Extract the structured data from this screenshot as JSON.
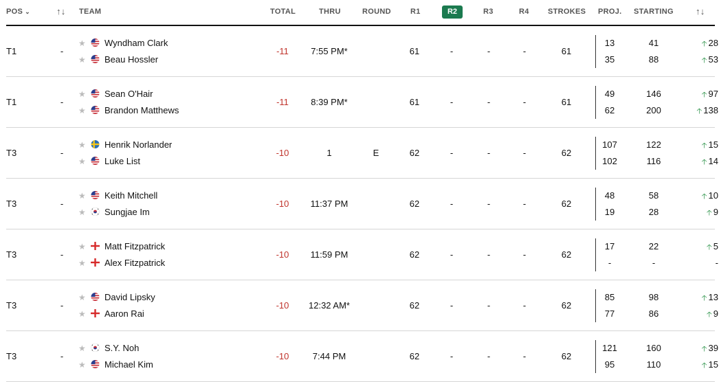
{
  "header": {
    "pos": "POS",
    "move": "↑↓",
    "team": "TEAM",
    "total": "TOTAL",
    "thru": "THRU",
    "round": "ROUND",
    "r1": "R1",
    "r2": "R2",
    "r3": "R3",
    "r4": "R4",
    "strokes": "STROKES",
    "proj": "PROJ.",
    "starting": "STARTING",
    "change": "↑↓"
  },
  "rows": [
    {
      "pos": "T1",
      "move": "-",
      "total": "-11",
      "thru": "7:55 PM*",
      "round": "",
      "r1": "61",
      "r2": "-",
      "r3": "-",
      "r4": "-",
      "strokes": "61",
      "players": [
        {
          "name": "Wyndham Clark",
          "flag": "usa-flag-icon",
          "proj": "13",
          "starting": "41",
          "change": "28",
          "up": true
        },
        {
          "name": "Beau Hossler",
          "flag": "usa-flag-icon",
          "proj": "35",
          "starting": "88",
          "change": "53",
          "up": true
        }
      ]
    },
    {
      "pos": "T1",
      "move": "-",
      "total": "-11",
      "thru": "8:39 PM*",
      "round": "",
      "r1": "61",
      "r2": "-",
      "r3": "-",
      "r4": "-",
      "strokes": "61",
      "players": [
        {
          "name": "Sean O'Hair",
          "flag": "usa-flag-icon",
          "proj": "49",
          "starting": "146",
          "change": "97",
          "up": true
        },
        {
          "name": "Brandon Matthews",
          "flag": "usa-flag-icon",
          "proj": "62",
          "starting": "200",
          "change": "138",
          "up": true
        }
      ]
    },
    {
      "pos": "T3",
      "move": "-",
      "total": "-10",
      "thru": "1",
      "round": "E",
      "r1": "62",
      "r2": "-",
      "r3": "-",
      "r4": "-",
      "strokes": "62",
      "players": [
        {
          "name": "Henrik Norlander",
          "flag": "sweden-flag-icon",
          "proj": "107",
          "starting": "122",
          "change": "15",
          "up": true
        },
        {
          "name": "Luke List",
          "flag": "usa-flag-icon",
          "proj": "102",
          "starting": "116",
          "change": "14",
          "up": true
        }
      ]
    },
    {
      "pos": "T3",
      "move": "-",
      "total": "-10",
      "thru": "11:37 PM",
      "round": "",
      "r1": "62",
      "r2": "-",
      "r3": "-",
      "r4": "-",
      "strokes": "62",
      "players": [
        {
          "name": "Keith Mitchell",
          "flag": "usa-flag-icon",
          "proj": "48",
          "starting": "58",
          "change": "10",
          "up": true
        },
        {
          "name": "Sungjae Im",
          "flag": "korea-flag-icon",
          "proj": "19",
          "starting": "28",
          "change": "9",
          "up": true
        }
      ]
    },
    {
      "pos": "T3",
      "move": "-",
      "total": "-10",
      "thru": "11:59 PM",
      "round": "",
      "r1": "62",
      "r2": "-",
      "r3": "-",
      "r4": "-",
      "strokes": "62",
      "players": [
        {
          "name": "Matt Fitzpatrick",
          "flag": "england-flag-icon",
          "proj": "17",
          "starting": "22",
          "change": "5",
          "up": true
        },
        {
          "name": "Alex Fitzpatrick",
          "flag": "england-flag-icon",
          "proj": "-",
          "starting": "-",
          "change": "-",
          "up": false
        }
      ]
    },
    {
      "pos": "T3",
      "move": "-",
      "total": "-10",
      "thru": "12:32 AM*",
      "round": "",
      "r1": "62",
      "r2": "-",
      "r3": "-",
      "r4": "-",
      "strokes": "62",
      "players": [
        {
          "name": "David Lipsky",
          "flag": "usa-flag-icon",
          "proj": "85",
          "starting": "98",
          "change": "13",
          "up": true
        },
        {
          "name": "Aaron Rai",
          "flag": "england-flag-icon",
          "proj": "77",
          "starting": "86",
          "change": "9",
          "up": true
        }
      ]
    },
    {
      "pos": "T3",
      "move": "-",
      "total": "-10",
      "thru": "7:44 PM",
      "round": "",
      "r1": "62",
      "r2": "-",
      "r3": "-",
      "r4": "-",
      "strokes": "62",
      "players": [
        {
          "name": "S.Y. Noh",
          "flag": "korea-flag-icon",
          "proj": "121",
          "starting": "160",
          "change": "39",
          "up": true
        },
        {
          "name": "Michael Kim",
          "flag": "usa-flag-icon",
          "proj": "95",
          "starting": "110",
          "change": "15",
          "up": true
        }
      ]
    }
  ]
}
